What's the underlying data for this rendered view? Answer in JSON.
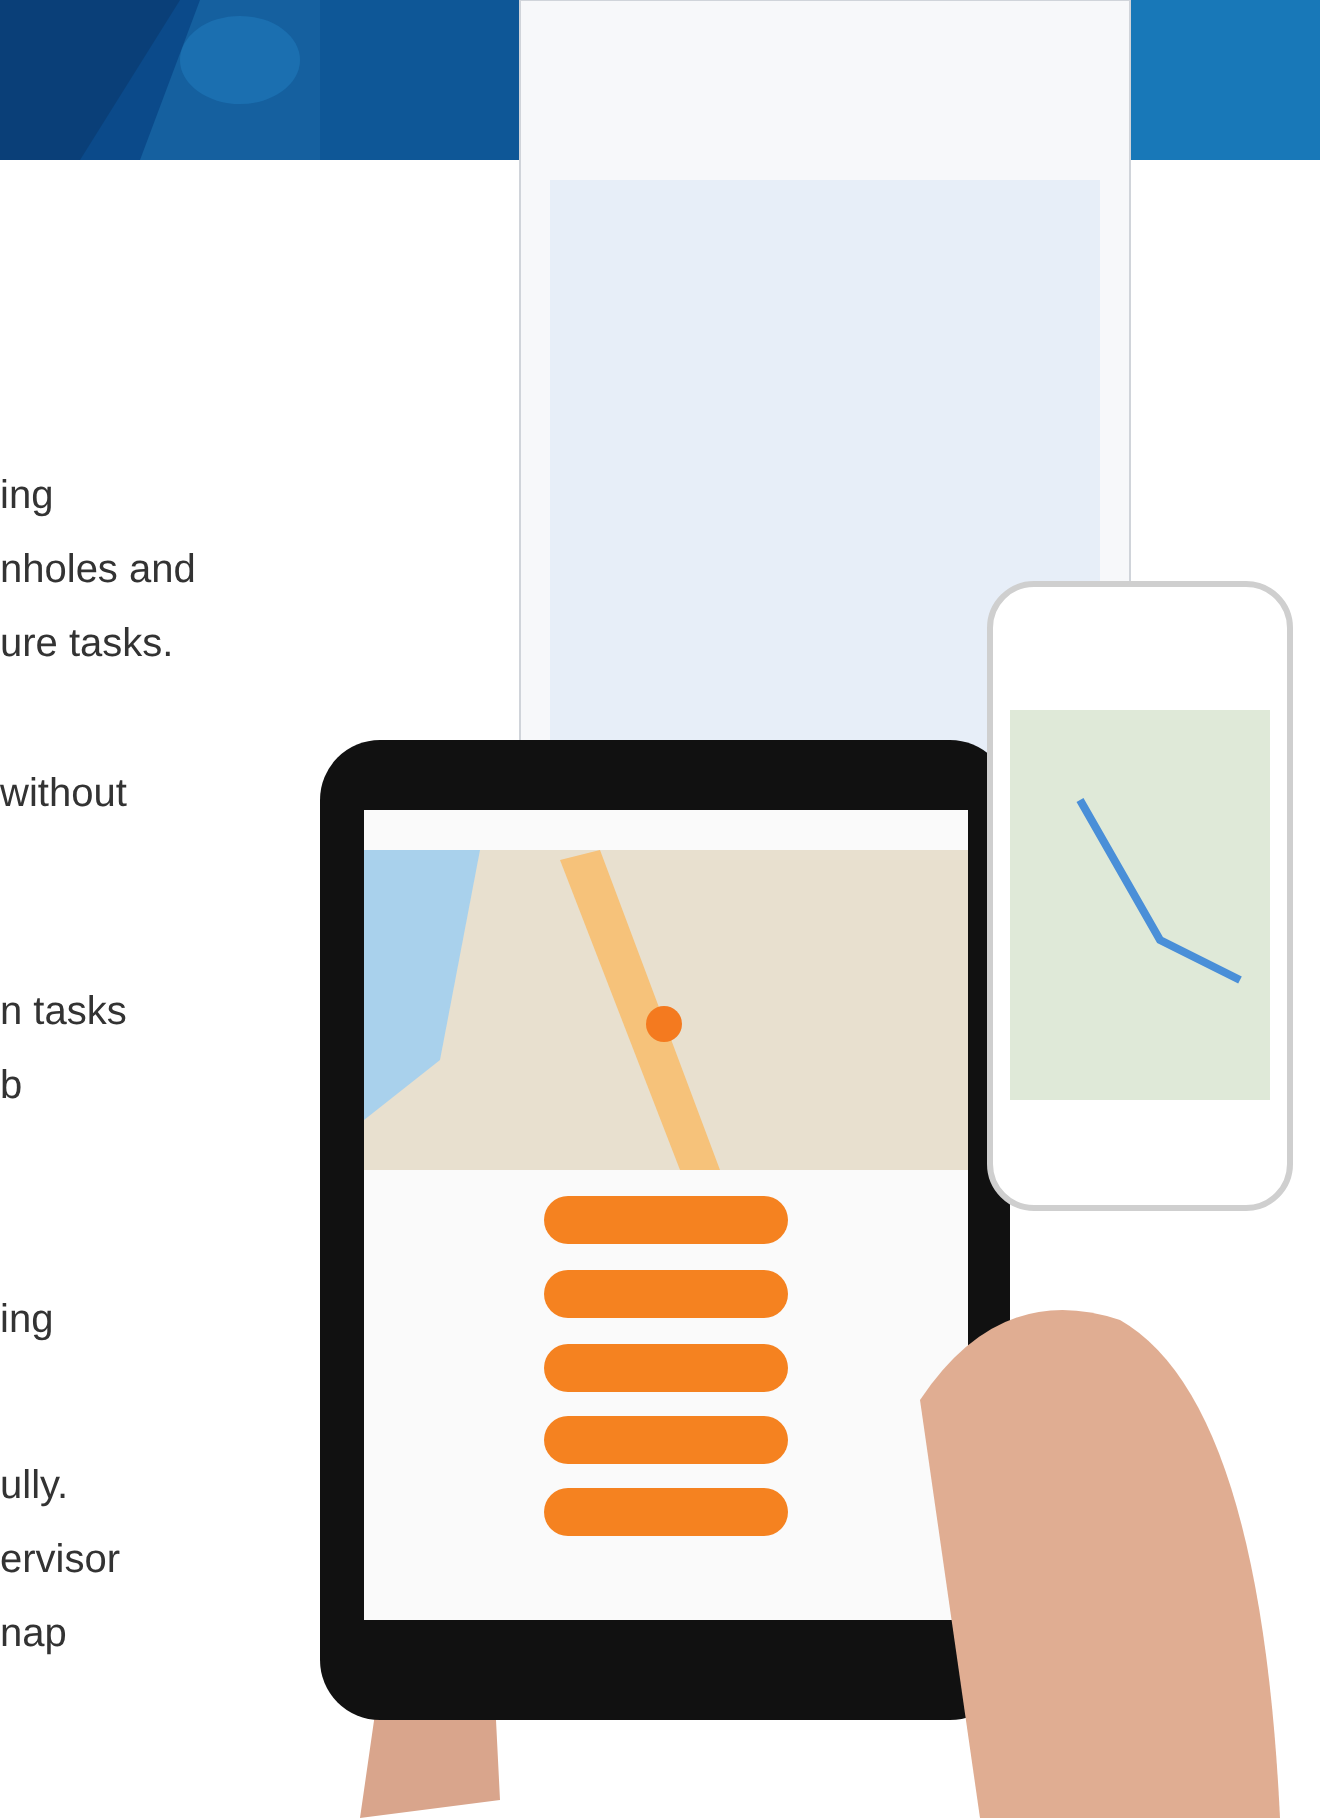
{
  "paragraphs": [
    {
      "lines": [
        "ing",
        "nholes and",
        "ure tasks."
      ]
    },
    {
      "lines": [
        "without"
      ]
    },
    {
      "lines": [
        "n tasks",
        "b"
      ]
    },
    {
      "lines": [
        "ing"
      ]
    },
    {
      "lines": [
        "ully.",
        "ervisor",
        "nap"
      ]
    }
  ]
}
